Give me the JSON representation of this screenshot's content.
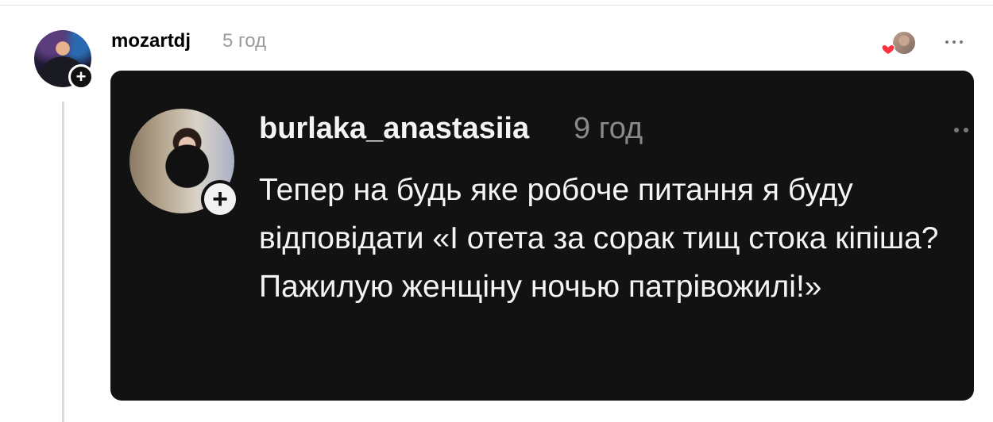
{
  "post": {
    "username": "mozartdj",
    "time": "5 год",
    "avatar_icon": "user-avatar",
    "follow_icon": "plus-icon",
    "more_icon": "more-dots-icon",
    "liked_by_icon": "heart-icon",
    "accent_heart_color": "#ff3040"
  },
  "quoted": {
    "username": "burlaka_anastasiia",
    "time": "9 год",
    "text": "Тепер на будь яке робоче питання я буду відповідати «І отета за сорак тищ стока кіпіша? Пажилую женщіну ночью патрівожилі!»",
    "follow_icon": "plus-icon",
    "more_icon": "more-dots-icon"
  },
  "colors": {
    "card_background": "#121212",
    "text_muted": "#9b9b9b"
  }
}
